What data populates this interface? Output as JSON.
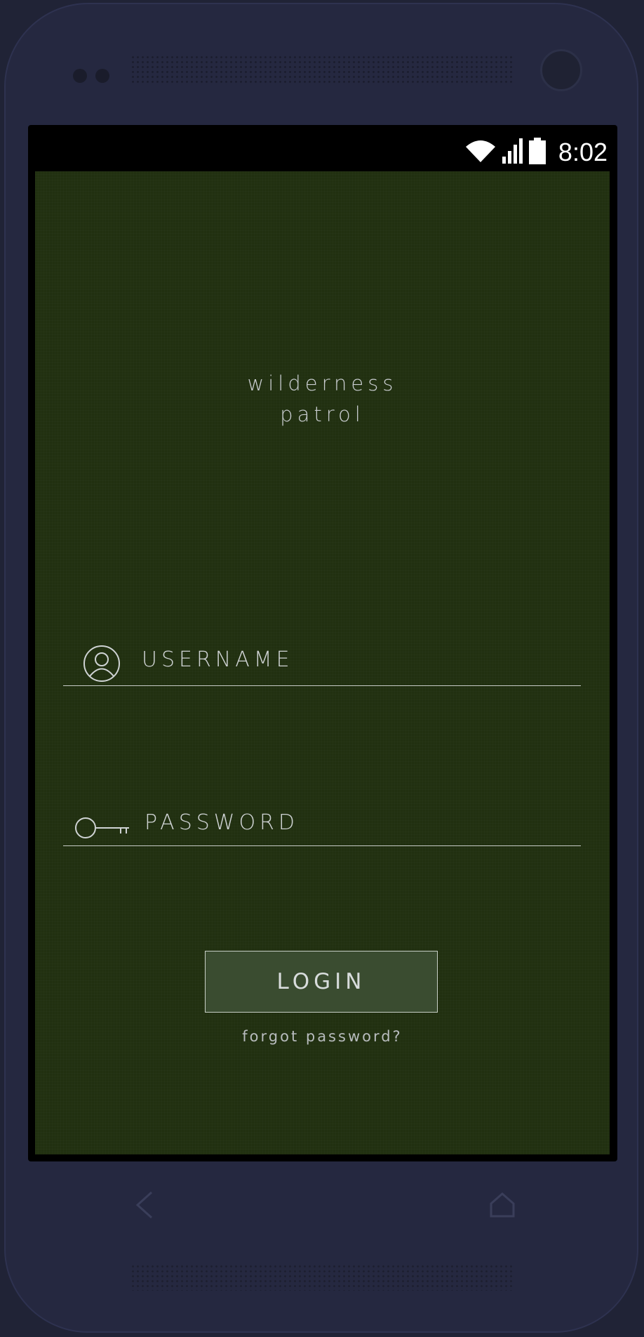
{
  "status_bar": {
    "time": "8:02",
    "icons": [
      "wifi-icon",
      "signal-icon",
      "battery-icon"
    ]
  },
  "app": {
    "title_line1": "wilderness",
    "title_line2": "patrol",
    "background_color": "#213010"
  },
  "login_form": {
    "username_label": "USERNAME",
    "username_icon": "user-icon",
    "password_label": "PASSWORD",
    "password_icon": "key-icon",
    "login_button_label": "LOGIN",
    "forgot_password_label": "forgot password?"
  },
  "navigation": {
    "icons": [
      "back-icon",
      "home-icon"
    ]
  }
}
